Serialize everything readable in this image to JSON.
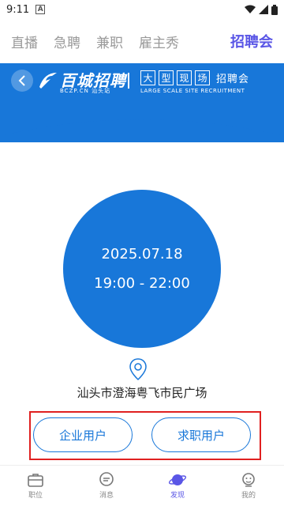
{
  "status_bar": {
    "time": "9:11",
    "app_icon": "A"
  },
  "tabs": [
    {
      "label": "直播"
    },
    {
      "label": "急聘"
    },
    {
      "label": "兼职"
    },
    {
      "label": "雇主秀"
    },
    {
      "label": "招聘会"
    }
  ],
  "active_tab": "招聘会",
  "header": {
    "logo_text": "百城招聘",
    "logo_sub": "BCZP.CN 汕头站",
    "fair_chars": [
      "大",
      "型",
      "现",
      "场"
    ],
    "fair_tail": "招聘会",
    "fair_en": "LARGE SCALE SITE RECRUITMENT"
  },
  "event": {
    "date": "2025.07.18",
    "time": "19:00 - 22:00",
    "venue": "汕头市澄海粤飞市民广场"
  },
  "actions": {
    "enterprise_label": "企业用户",
    "jobseeker_label": "求职用户"
  },
  "bottom_nav": [
    {
      "label": "职位",
      "icon": "briefcase-icon"
    },
    {
      "label": "消息",
      "icon": "chat-icon"
    },
    {
      "label": "发现",
      "icon": "planet-icon"
    },
    {
      "label": "我的",
      "icon": "user-icon"
    }
  ],
  "colors": {
    "primary": "#1877d9",
    "accent": "#5a56e6",
    "highlight": "#e02020"
  }
}
